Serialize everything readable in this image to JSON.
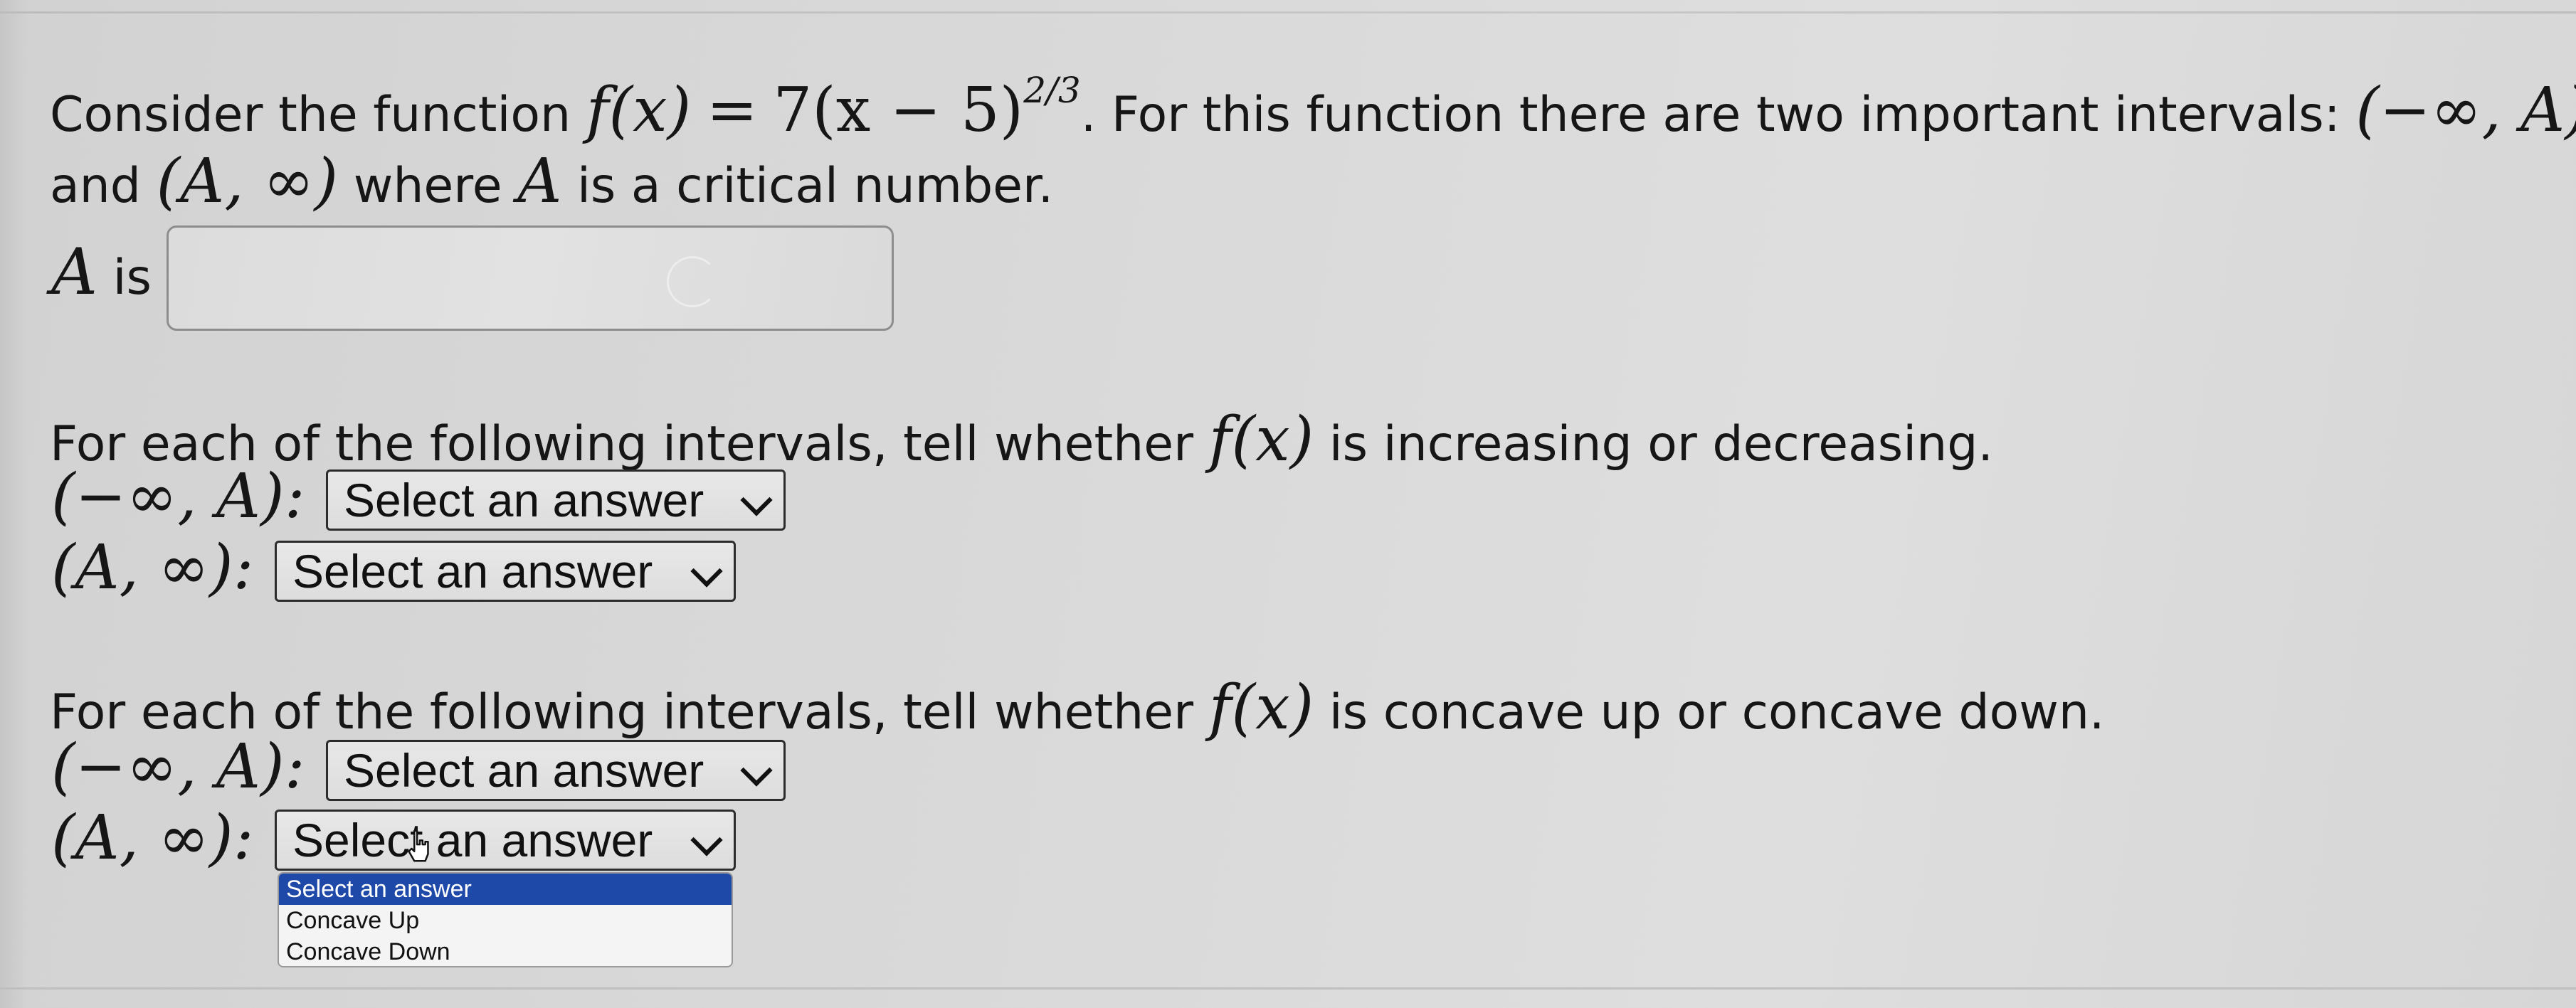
{
  "question": {
    "intro_text": "Consider the function",
    "function_lhs": "f(x)",
    "equals": "=",
    "function_rhs": "7(x − 5)",
    "exponent": "2/3",
    "intro_text_after": ". For this function there are two important intervals:",
    "interval_left_first_line": "(−∞, A)",
    "line2_and": "and",
    "interval_right": "(A, ∞)",
    "line2_where": "where",
    "var_A": "A",
    "line2_tail": "is a critical number."
  },
  "critical_number": {
    "label_var": "A",
    "label_is": "is",
    "value": ""
  },
  "increasing_section": {
    "prompt_before": "For each of the following intervals, tell whether",
    "fx": "f(x)",
    "prompt_after": "is increasing or decreasing.",
    "rows": [
      {
        "interval": "(−∞, A):",
        "selected": "Select an answer"
      },
      {
        "interval": "(A, ∞):",
        "selected": "Select an answer"
      }
    ]
  },
  "concavity_section": {
    "prompt_before": "For each of the following intervals, tell whether",
    "fx": "f(x)",
    "prompt_after": "is concave up or concave down.",
    "rows": [
      {
        "interval": "(−∞, A):",
        "selected": "Select an answer"
      },
      {
        "interval": "(A, ∞):",
        "selected": "Select an answer"
      }
    ]
  },
  "dropdown_options": [
    "Select an answer",
    "Concave Up",
    "Concave Down"
  ],
  "colors": {
    "highlight": "#1f49a8",
    "background": "#d9d9d9"
  },
  "icons": {
    "select_chevron": "chevron-down-icon",
    "cursor": "hand-pointer-icon",
    "loading": "spinner-icon"
  }
}
